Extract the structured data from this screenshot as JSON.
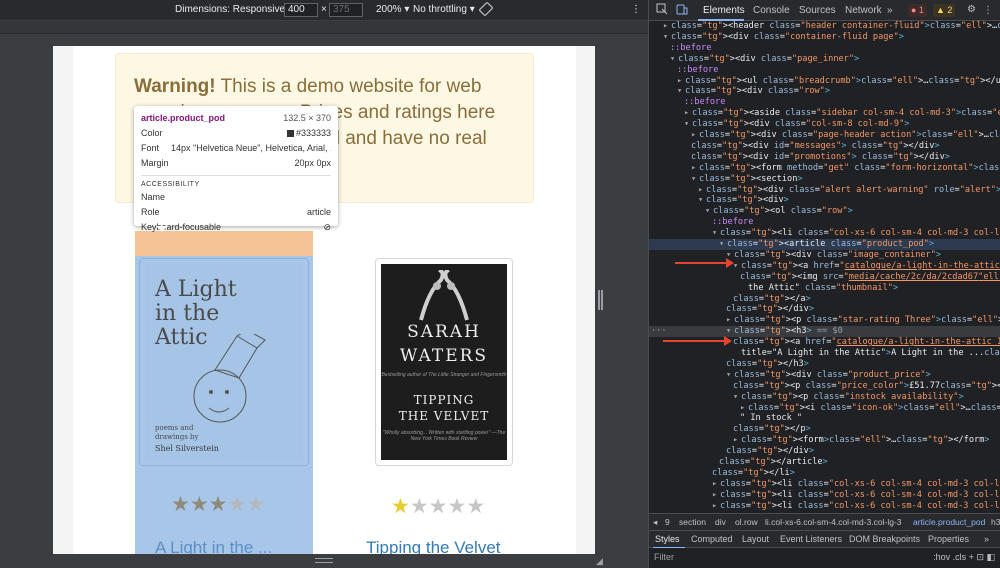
{
  "device_toolbar": {
    "dimensions": "Dimensions: Responsive ▾",
    "width": "400",
    "x": "×",
    "height": "375",
    "zoom": "200% ▾",
    "throttle": "No throttling ▾",
    "more": "⋮"
  },
  "page": {
    "alert": {
      "strong": "Warning!",
      "text": " This is a demo website for web scraping purposes. Prices and ratings here were randomly assigned and have no real meaning."
    },
    "products": [
      {
        "title": "A Light in the ...",
        "rating": 3,
        "cover": {
          "title": "A Light in the Attic",
          "subtitle": "poems and drawings by",
          "author": "Shel Silverstein"
        }
      },
      {
        "title": "Tipping the Velvet",
        "rating": 1,
        "cover": {
          "author_line1": "SARAH",
          "author_line2": "WATERS",
          "tagline": "Bestselling author of The Little Stranger and Fingersmith",
          "title_line1": "TIPPING",
          "title_line2": "THE VELVET",
          "quote": "\"Wholly absorbing... Written with startling power\" —The New York Times Book Review"
        }
      }
    ]
  },
  "tooltip": {
    "selector": "article.product_pod",
    "size": "132.5 × 370",
    "color_label": "Color",
    "color_value": "#333333",
    "font_label": "Font",
    "font_value": "14px \"Helvetica Neue\", Helvetica, Arial, ...",
    "margin_label": "Margin",
    "margin_value": "20px 0px",
    "section": "ACCESSIBILITY",
    "name_label": "Name",
    "name_value": "",
    "role_label": "Role",
    "role_value": "article",
    "keyboard_label": "Keyboard-focusable",
    "keyboard_icon": "⊘"
  },
  "devtools": {
    "tabs": [
      "Elements",
      "Console",
      "Sources",
      "Network",
      "»"
    ],
    "errors": "● 1",
    "warnings": "▲ 2",
    "settings_icon": "⚙",
    "more_icon": "⋮",
    "close_icon": "✕",
    "dom_lines": [
      "<header class=\"header container-fluid\">…</header>",
      "<div class=\"container-fluid page\">",
      "::before",
      "<div class=\"page_inner\">",
      "::before",
      "<ul class=\"breadcrumb\">…</ul>",
      "<div class=\"row\">",
      "::before",
      "<aside class=\"sidebar col-sm-4 col-md-3\">…</aside>",
      "<div class=\"col-sm-8 col-md-9\">",
      "<div class=\"page-header action\">…</div>",
      "<div id=\"messages\"> </div>",
      "<div id=\"promotions\"> </div>",
      "<form method=\"get\" class=\"form-horizontal\">…</form>",
      "<section>",
      "<div class=\"alert alert-warning\" role=\"alert\">…</div>",
      "<div>",
      "<ol class=\"row\">",
      "::before",
      "<li class=\"col-xs-6 col-sm-4 col-md-3 col-lg-3\">",
      "<article class=\"product_pod\">",
      "<div class=\"image_container\">",
      "<a href=\"catalogue/a-light-in-the-attic_1000/index.html\">",
      "<img src=\"media/cache/2c/da/2cdad67….jpg\" alt=\"A Light in",
      "the Attic\" class=\"thumbnail\">",
      "</a>",
      "</div>",
      "<p class=\"star-rating Three\">…</p>",
      "<h3> == $0",
      "<a href=\"catalogue/a-light-in-the-attic_1000/index.html\"",
      "title=\"A Light in the Attic\">A Light in the ...</a>",
      "</h3>",
      "<div class=\"product_price\">",
      "<p class=\"price_color\">£51.77</p>",
      "<p class=\"instock availability\">",
      "<i class=\"icon-ok\">…</i>",
      "\" In stock \"",
      "</p>",
      "<form>…</form>",
      "</div>",
      "</article>",
      "</li>",
      "<li class=\"col-xs-6 col-sm-4 col-md-3 col-lg-3\">…</li>",
      "<li class=\"col-xs-6 col-sm-4 col-md-3 col-lg-3\">…</li>",
      "<li class=\"col-xs-6 col-sm-4 col-md-3 col-lg-3\">…</li>"
    ],
    "breadcrumbs": [
      "◂",
      "9",
      "section",
      "div",
      "ol.row",
      "li.col-xs-6.col-sm-4.col-md-3.col-lg-3",
      "article.product_pod",
      "h3"
    ],
    "sub_tabs": [
      "Styles",
      "Computed",
      "Layout",
      "Event Listeners",
      "DOM Breakpoints",
      "Properties",
      "»"
    ],
    "filter_placeholder": "Filter",
    "filter_tools": ":hov  .cls  +  ⊡  ◧"
  }
}
